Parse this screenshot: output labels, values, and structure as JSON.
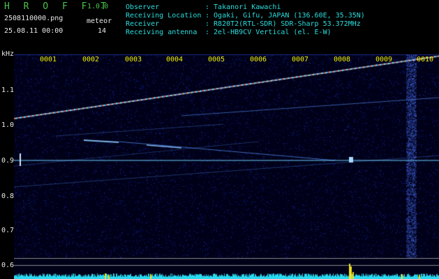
{
  "app": {
    "title": "H R O F F T",
    "version": "1.0.0",
    "filename": "2508110000.png",
    "datetime": "25.08.11 00:00"
  },
  "meteor": {
    "label": "meteor",
    "count": "14"
  },
  "info": {
    "labels": [
      "Observer",
      "Receiving Location",
      "Receiver",
      "Receiving antenna"
    ],
    "values": [
      ": Takanori Kawachi",
      ": Ogaki, Gifu, JAPAN (136.60E, 35.35N)",
      ": R820T2(RTL-SDR) SDR-Sharp 53.372MHz",
      ": 2el-HB9CV Vertical (el. E-W)"
    ]
  },
  "spectrogram": {
    "y_unit": "kHz",
    "y_ticks": [
      "1.1",
      "1.0",
      "0.9",
      "0.8",
      "0.7",
      "0.6"
    ],
    "minutes": [
      "0001",
      "0002",
      "0003",
      "0004",
      "0005",
      "0006",
      "0007",
      "0008",
      "0009",
      "0010"
    ],
    "colors": {
      "background": "#000018",
      "noise": "#1a2ad8",
      "signal": "#6fd0ff",
      "baseline": "#29d9f0",
      "spike": "#f2e020"
    }
  }
}
